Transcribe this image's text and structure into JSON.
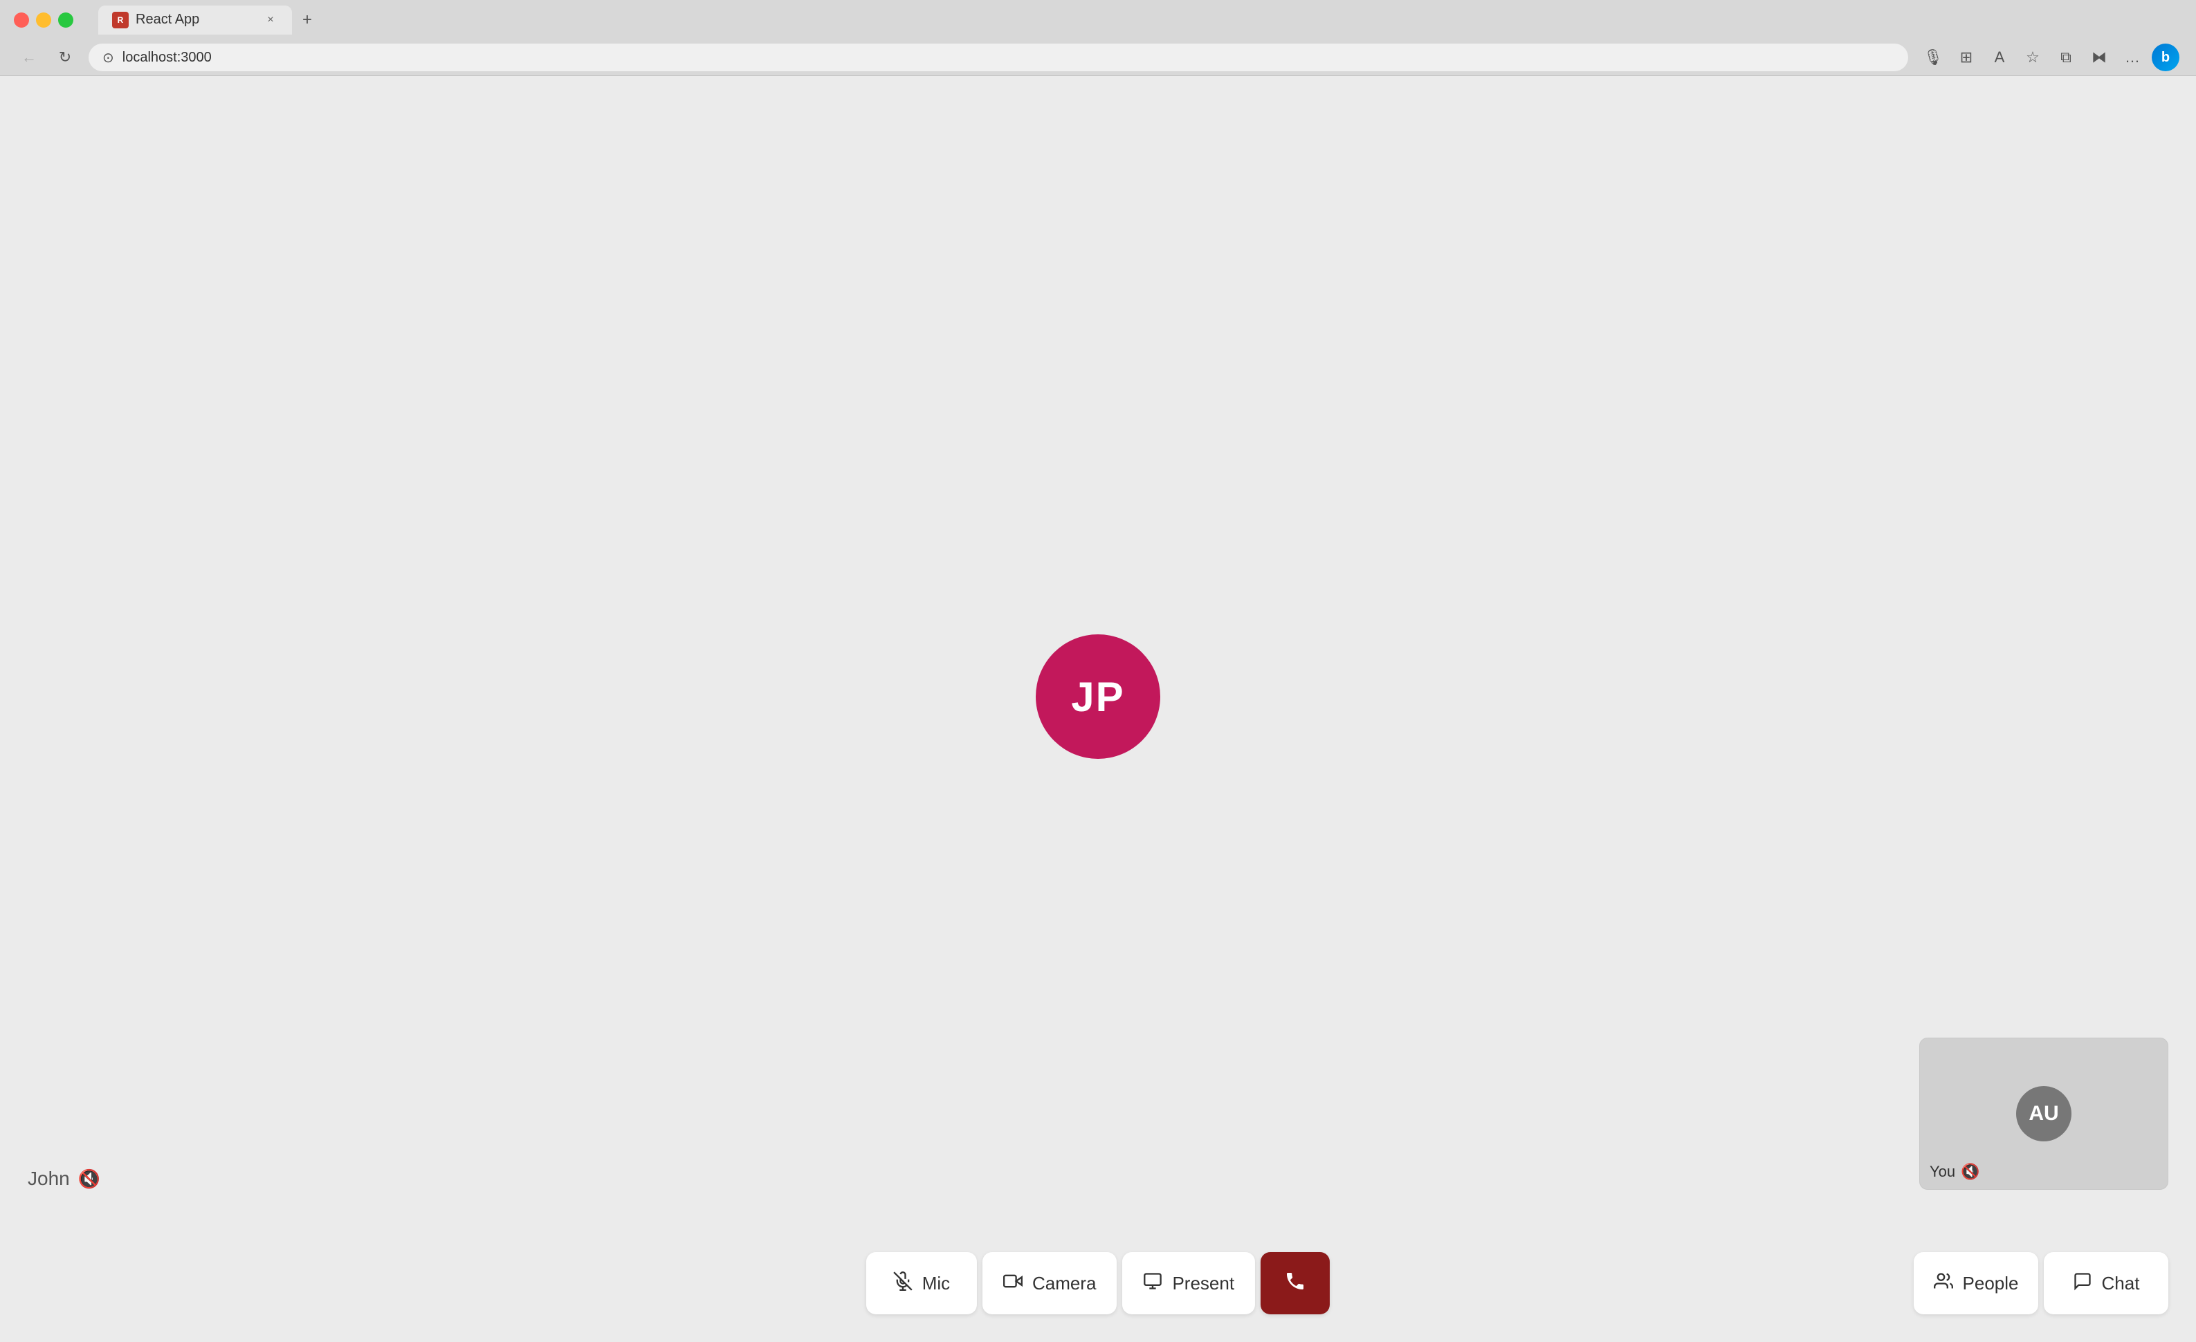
{
  "browser": {
    "tab_title": "React App",
    "tab_favicon_letter": "R",
    "url": "localhost:3000",
    "close_label": "×",
    "new_tab_label": "+"
  },
  "nav": {
    "back_icon": "←",
    "refresh_icon": "↻",
    "address_icon": "⊙"
  },
  "toolbar": {
    "mic_icon": "🎙",
    "grid_icon": "⊞",
    "read_icon": "A",
    "star_icon": "☆",
    "split_icon": "⧉",
    "extensions_icon": "⧓",
    "more_icon": "…",
    "bing_label": "b"
  },
  "call": {
    "main_avatar_initials": "JP",
    "main_avatar_color": "#c2185b"
  },
  "participant": {
    "name": "John",
    "muted": true,
    "muted_icon": "🔇"
  },
  "self_view": {
    "initials": "AU",
    "label": "You",
    "muted": true,
    "muted_icon": "🔇"
  },
  "controls": {
    "mic_label": "Mic",
    "mic_icon": "🎤",
    "mic_muted": true,
    "camera_label": "Camera",
    "camera_icon": "📷",
    "present_label": "Present",
    "present_icon": "🖥",
    "end_call_icon": "📞"
  },
  "right_controls": {
    "people_label": "People",
    "people_icon": "👥",
    "chat_label": "Chat",
    "chat_icon": "💬"
  }
}
